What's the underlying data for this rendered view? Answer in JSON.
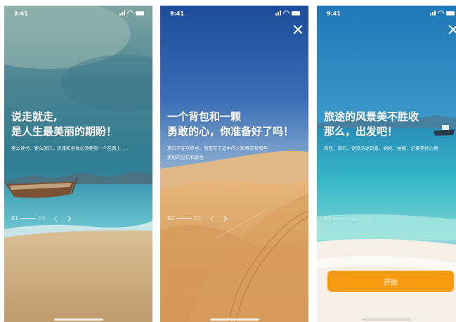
{
  "status": {
    "time": "9:41"
  },
  "screens": [
    {
      "title_line1": "说走就走,",
      "title_line2": "是人生最美丽的期盼！",
      "desc_line1": "要么读书、要么旅行，灵魂和身体必须要有一个在路上 ...",
      "desc_line2": "",
      "pager_current": "01",
      "pager_total": "03"
    },
    {
      "title_line1": "一个背包和一颗",
      "title_line2": "勇敢的心，你准备好了吗！",
      "desc_line1": "旅行不在乎终点，而是在于途中的人和事还有那些",
      "desc_line2": "美好的记忆和景色",
      "pager_current": "02",
      "pager_total": "03"
    },
    {
      "title_line1": "旅途的风景美不胜收",
      "title_line2": "那么，出发吧！",
      "desc_line1": "背包、旅行，饱览沿途风景，相机、拍摄，记录美好心情",
      "desc_line2": "",
      "pager_current": "03",
      "pager_total": "03",
      "start_label": "开始"
    }
  ],
  "icons": [
    "signal-icon",
    "wifi-icon",
    "battery-icon",
    "close-icon",
    "arrow-left-icon",
    "arrow-right-icon"
  ],
  "colors": {
    "start_button": "#f99b10",
    "text": "#ffffff"
  }
}
